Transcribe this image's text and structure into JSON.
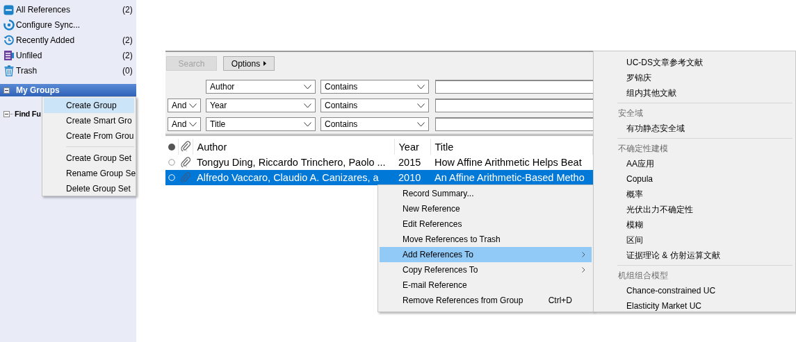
{
  "sidebar": {
    "items": [
      {
        "kind": "all",
        "label": "All References",
        "count": "(2)"
      },
      {
        "kind": "sync",
        "label": "Configure Sync..."
      },
      {
        "kind": "recent",
        "label": "Recently Added",
        "count": "(2)"
      },
      {
        "kind": "unfiled",
        "label": "Unfiled",
        "count": "(2)"
      },
      {
        "kind": "trash",
        "label": "Trash",
        "count": "(0)"
      }
    ],
    "groups_header": {
      "label": "My Groups",
      "expanded": true
    },
    "find_full_text": {
      "label": "Find Fu",
      "expanded": true
    }
  },
  "group_menu": {
    "items": [
      {
        "kind": "item",
        "label": "Create Group",
        "selected": true
      },
      {
        "kind": "item",
        "label": "Create Smart Gro",
        "selected": false
      },
      {
        "kind": "item",
        "label": "Create From Grou",
        "selected": false
      },
      {
        "kind": "separator"
      },
      {
        "kind": "item",
        "label": "Create Group Set",
        "selected": false
      },
      {
        "kind": "item",
        "label": "Rename Group Se",
        "selected": false
      },
      {
        "kind": "item",
        "label": "Delete Group Set",
        "selected": false
      }
    ]
  },
  "search": {
    "search_button": {
      "label": "Search",
      "disabled": true
    },
    "options_button": {
      "label": "Options"
    },
    "rows": [
      {
        "field": "Author",
        "operator": "Contains"
      },
      {
        "connector": "And",
        "field": "Year",
        "operator": "Contains"
      },
      {
        "connector": "And",
        "field": "Title",
        "operator": "Contains"
      }
    ]
  },
  "table": {
    "columns": [
      "Author",
      "Year",
      "Title"
    ],
    "rows": [
      {
        "author": "Tongyu Ding, Riccardo Trinchero, Paolo ...",
        "year": "2015",
        "title": "How Affine Arithmetic Helps Beat",
        "selected": false
      },
      {
        "author": "Alfredo Vaccaro, Claudio A. Canizares, a",
        "year": "2010",
        "title": "An Affine Arithmetic-Based Metho",
        "selected": true
      }
    ]
  },
  "context_menu": {
    "items": [
      {
        "label": "Record Summary...",
        "submenu": false,
        "selected": false
      },
      {
        "label": "New Reference",
        "submenu": false,
        "selected": false
      },
      {
        "label": "Edit References",
        "submenu": false,
        "selected": false
      },
      {
        "label": "Move References to Trash",
        "submenu": false,
        "selected": false
      },
      {
        "label": "Add References To",
        "submenu": true,
        "selected": true
      },
      {
        "label": "Copy References To",
        "submenu": true,
        "selected": false
      },
      {
        "label": "E-mail Reference",
        "submenu": false,
        "selected": false
      },
      {
        "label": "Remove References from Group",
        "shortcut": "Ctrl+D",
        "submenu": false,
        "selected": false
      }
    ]
  },
  "submenu": {
    "items": [
      {
        "kind": "item",
        "label": "UC-DS文章参考文献"
      },
      {
        "kind": "item",
        "label": "罗锦庆"
      },
      {
        "kind": "item",
        "label": "组内其他文献"
      },
      {
        "kind": "separator"
      },
      {
        "kind": "header",
        "label": "安全域"
      },
      {
        "kind": "item",
        "label": "有功静态安全域"
      },
      {
        "kind": "separator"
      },
      {
        "kind": "header",
        "label": "不确定性建模"
      },
      {
        "kind": "item",
        "label": "AA应用"
      },
      {
        "kind": "item",
        "label": "Copula"
      },
      {
        "kind": "item",
        "label": "概率"
      },
      {
        "kind": "item",
        "label": "光伏出力不确定性"
      },
      {
        "kind": "item",
        "label": "模糊"
      },
      {
        "kind": "item",
        "label": "区间"
      },
      {
        "kind": "item",
        "label": "证据理论 &  仿射运算文献"
      },
      {
        "kind": "separator"
      },
      {
        "kind": "header",
        "label": "机组组合模型"
      },
      {
        "kind": "item",
        "label": "Chance-constrained UC"
      },
      {
        "kind": "item",
        "label": "Elasticity Market UC"
      }
    ]
  }
}
